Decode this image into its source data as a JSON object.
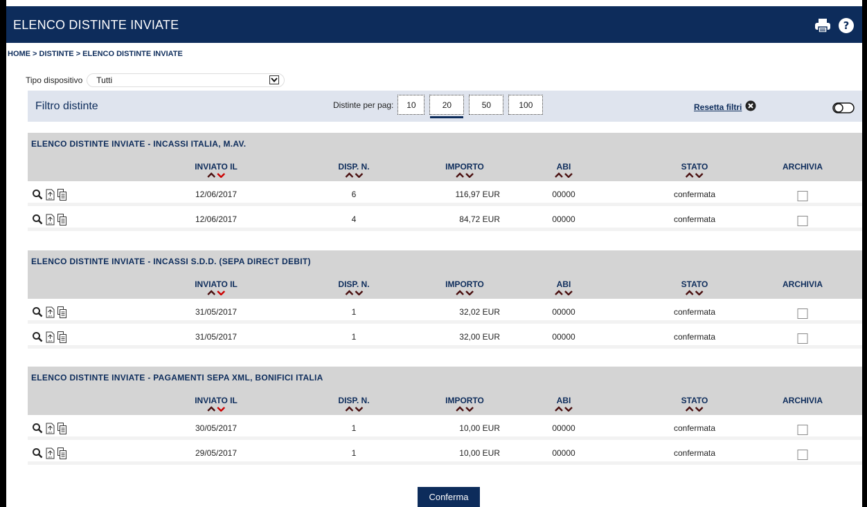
{
  "header": {
    "title": "ELENCO DISTINTE INVIATE",
    "icons": [
      "print-icon",
      "help-icon"
    ]
  },
  "breadcrumb": "HOME > DISTINTE > ELENCO DISTINTE INVIATE",
  "tipo": {
    "label": "Tipo dispositivo",
    "value": "Tutti"
  },
  "filter": {
    "title": "Filtro distinte",
    "per_page_label": "Distinte per pag:",
    "per_page_options": [
      "10",
      "20",
      "50",
      "100"
    ],
    "per_page_selected": "20",
    "reset_label": "Resetta filtri"
  },
  "columns": {
    "inviato": "INVIATO IL",
    "disp": "DISP. N.",
    "importo": "IMPORTO",
    "abi": "ABI",
    "stato": "STATO",
    "archivia": "ARCHIVIA"
  },
  "sections": [
    {
      "title": "ELENCO DISTINTE INVIATE - INCASSI ITALIA, M.AV.",
      "rows": [
        {
          "date": "12/06/2017",
          "disp": "6",
          "importo": "116,97 EUR",
          "abi": "00000",
          "stato": "confermata"
        },
        {
          "date": "12/06/2017",
          "disp": "4",
          "importo": "84,72 EUR",
          "abi": "00000",
          "stato": "confermata"
        }
      ]
    },
    {
      "title": "ELENCO DISTINTE INVIATE - INCASSI S.D.D. (SEPA DIRECT DEBIT)",
      "rows": [
        {
          "date": "31/05/2017",
          "disp": "1",
          "importo": "32,02 EUR",
          "abi": "00000",
          "stato": "confermata"
        },
        {
          "date": "31/05/2017",
          "disp": "1",
          "importo": "32,00 EUR",
          "abi": "00000",
          "stato": "confermata"
        }
      ]
    },
    {
      "title": "ELENCO DISTINTE INVIATE - PAGAMENTI SEPA XML, BONIFICI ITALIA",
      "rows": [
        {
          "date": "30/05/2017",
          "disp": "1",
          "importo": "10,00 EUR",
          "abi": "00000",
          "stato": "confermata"
        },
        {
          "date": "29/05/2017",
          "disp": "1",
          "importo": "10,00 EUR",
          "abi": "00000",
          "stato": "confermata"
        }
      ]
    }
  ],
  "confirm_label": "Conferma",
  "colors": {
    "navy": "#0d2c5b",
    "sort_active": "#cc0000",
    "section_bg": "#d4d4d4",
    "filter_bg": "#dfe4ee"
  }
}
